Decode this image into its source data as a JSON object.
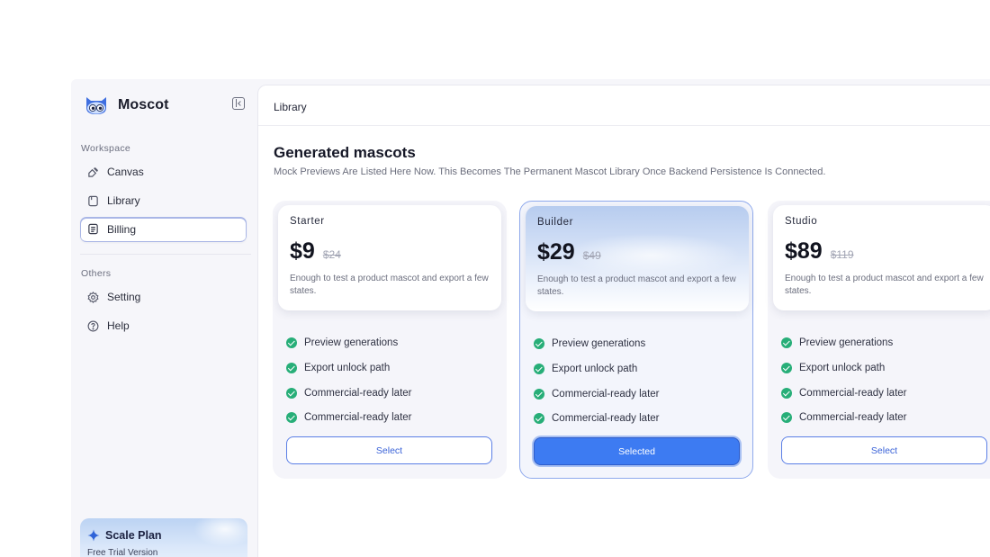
{
  "brand": {
    "name": "Moscot"
  },
  "sidebar": {
    "workspace_label": "Workspace",
    "workspace_items": [
      {
        "label": "Canvas",
        "icon": "canvas-icon"
      },
      {
        "label": "Library",
        "icon": "library-icon"
      },
      {
        "label": "Billing",
        "icon": "billing-icon",
        "active": true
      }
    ],
    "others_label": "Others",
    "others_items": [
      {
        "label": "Setting",
        "icon": "gear-icon"
      },
      {
        "label": "Help",
        "icon": "help-icon"
      }
    ],
    "plan_card": {
      "title": "Scale Plan",
      "subtitle": "Free Trial Version"
    }
  },
  "topbar": {
    "title": "Library"
  },
  "page": {
    "title": "Generated mascots",
    "subtitle": "Mock Previews Are Listed Here Now. This Becomes The Permanent Mascot Library Once Backend Persistence Is Connected."
  },
  "plans": [
    {
      "name": "Starter",
      "price": "$9",
      "old_price": "$24",
      "description": "Enough to test a product mascot and export a few states.",
      "features": [
        "Preview generations",
        "Export unlock path",
        "Commercial-ready later",
        "Commercial-ready later"
      ],
      "button": "Select",
      "selected": false
    },
    {
      "name": "Builder",
      "price": "$29",
      "old_price": "$49",
      "description": "Enough to test a product mascot and export a few states.",
      "features": [
        "Preview generations",
        "Export unlock path",
        "Commercial-ready later",
        "Commercial-ready later"
      ],
      "button": "Selected",
      "selected": true
    },
    {
      "name": "Studio",
      "price": "$89",
      "old_price": "$119",
      "description": "Enough to test a product mascot and export a few states.",
      "features": [
        "Preview generations",
        "Export unlock path",
        "Commercial-ready later",
        "Commercial-ready later"
      ],
      "button": "Select",
      "selected": false
    }
  ],
  "colors": {
    "accent": "#3d7bf2",
    "check": "#27ae78",
    "selected_border": "#8fa9ec"
  }
}
